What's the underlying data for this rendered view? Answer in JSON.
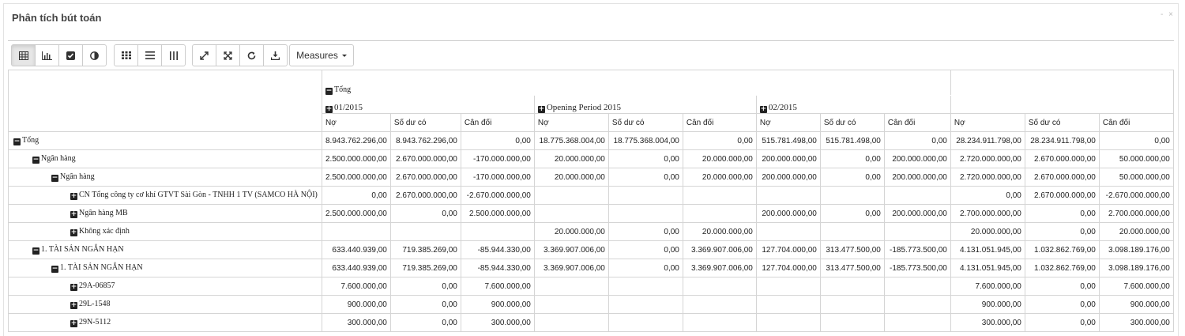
{
  "panel": {
    "title": "Phân tích bút toán",
    "controls": "- ×"
  },
  "toolbar": {
    "view_buttons": [
      "table-icon",
      "bar-chart-icon",
      "check-square-icon",
      "pie-icon"
    ],
    "layout_buttons": [
      "grid-icon",
      "list-icon",
      "columns-icon"
    ],
    "action_buttons": [
      "expand-icon",
      "collapse-icon",
      "refresh-icon",
      "download-icon"
    ],
    "measures_label": "Measures"
  },
  "pivot": {
    "top_header": "Tổng",
    "periods": [
      "01/2015",
      "Opening Period 2015",
      "02/2015"
    ],
    "measures": [
      "Nợ",
      "Số dư có",
      "Cân đối"
    ],
    "rows": [
      {
        "label": "Tổng",
        "level": 0,
        "sign": "−",
        "values": [
          "8.943.762.296,00",
          "8.943.762.296,00",
          "0,00",
          "18.775.368.004,00",
          "18.775.368.004,00",
          "0,00",
          "515.781.498,00",
          "515.781.498,00",
          "0,00"
        ],
        "totals": [
          "28.234.911.798,00",
          "28.234.911.798,00",
          "0,00"
        ]
      },
      {
        "label": "Ngân hàng",
        "level": 1,
        "sign": "−",
        "values": [
          "2.500.000.000,00",
          "2.670.000.000,00",
          "-170.000.000,00",
          "20.000.000,00",
          "0,00",
          "20.000.000,00",
          "200.000.000,00",
          "0,00",
          "200.000.000,00"
        ],
        "totals": [
          "2.720.000.000,00",
          "2.670.000.000,00",
          "50.000.000,00"
        ]
      },
      {
        "label": "Ngân hàng",
        "level": 2,
        "sign": "−",
        "values": [
          "2.500.000.000,00",
          "2.670.000.000,00",
          "-170.000.000,00",
          "20.000.000,00",
          "0,00",
          "20.000.000,00",
          "200.000.000,00",
          "0,00",
          "200.000.000,00"
        ],
        "totals": [
          "2.720.000.000,00",
          "2.670.000.000,00",
          "50.000.000,00"
        ]
      },
      {
        "label": "CN Tổng công ty cơ khí GTVT Sài Gòn - TNHH 1 TV (SAMCO HÀ NỘI)",
        "level": 3,
        "sign": "+",
        "values": [
          "0,00",
          "2.670.000.000,00",
          "-2.670.000.000,00",
          "",
          "",
          "",
          "",
          "",
          ""
        ],
        "totals": [
          "0,00",
          "2.670.000.000,00",
          "-2.670.000.000,00"
        ]
      },
      {
        "label": "Ngân hàng MB",
        "level": 3,
        "sign": "+",
        "values": [
          "2.500.000.000,00",
          "0,00",
          "2.500.000.000,00",
          "",
          "",
          "",
          "200.000.000,00",
          "0,00",
          "200.000.000,00"
        ],
        "totals": [
          "2.700.000.000,00",
          "0,00",
          "2.700.000.000,00"
        ]
      },
      {
        "label": "Không xác định",
        "level": 3,
        "sign": "+",
        "values": [
          "",
          "",
          "",
          "20.000.000,00",
          "0,00",
          "20.000.000,00",
          "",
          "",
          ""
        ],
        "totals": [
          "20.000.000,00",
          "0,00",
          "20.000.000,00"
        ]
      },
      {
        "label": "1. TÀI SẢN NGẮN HẠN",
        "level": 1,
        "sign": "−",
        "values": [
          "633.440.939,00",
          "719.385.269,00",
          "-85.944.330,00",
          "3.369.907.006,00",
          "0,00",
          "3.369.907.006,00",
          "127.704.000,00",
          "313.477.500,00",
          "-185.773.500,00"
        ],
        "totals": [
          "4.131.051.945,00",
          "1.032.862.769,00",
          "3.098.189.176,00"
        ]
      },
      {
        "label": "1. TÀI SẢN NGẮN HẠN",
        "level": 2,
        "sign": "−",
        "values": [
          "633.440.939,00",
          "719.385.269,00",
          "-85.944.330,00",
          "3.369.907.006,00",
          "0,00",
          "3.369.907.006,00",
          "127.704.000,00",
          "313.477.500,00",
          "-185.773.500,00"
        ],
        "totals": [
          "4.131.051.945,00",
          "1.032.862.769,00",
          "3.098.189.176,00"
        ]
      },
      {
        "label": "29A-06857",
        "level": 3,
        "sign": "+",
        "values": [
          "7.600.000,00",
          "0,00",
          "7.600.000,00",
          "",
          "",
          "",
          "",
          "",
          ""
        ],
        "totals": [
          "7.600.000,00",
          "0,00",
          "7.600.000,00"
        ]
      },
      {
        "label": "29L-1548",
        "level": 3,
        "sign": "+",
        "values": [
          "900.000,00",
          "0,00",
          "900.000,00",
          "",
          "",
          "",
          "",
          "",
          ""
        ],
        "totals": [
          "900.000,00",
          "0,00",
          "900.000,00"
        ]
      },
      {
        "label": "29N-5112",
        "level": 3,
        "sign": "+",
        "values": [
          "300.000,00",
          "0,00",
          "300.000,00",
          "",
          "",
          "",
          "",
          "",
          ""
        ],
        "totals": [
          "300.000,00",
          "0,00",
          "300.000,00"
        ]
      }
    ]
  }
}
